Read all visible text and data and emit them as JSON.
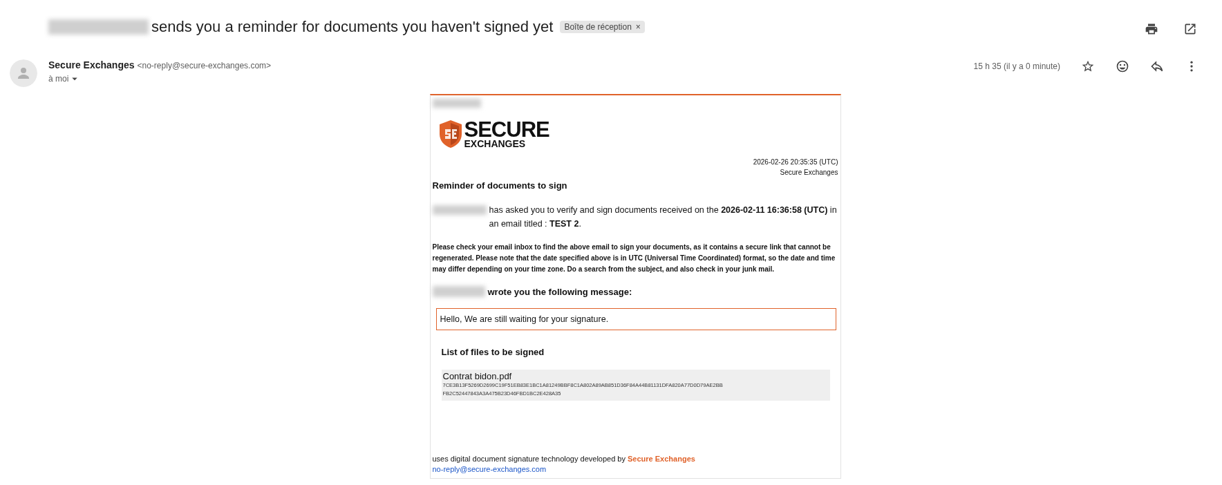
{
  "subject": {
    "text": "sends you a reminder for documents you haven't signed yet",
    "label_chip": "Boîte de réception",
    "chip_close": "×"
  },
  "sender": {
    "name": "Secure Exchanges",
    "address": "<no-reply@secure-exchanges.com>",
    "recipient": "à moi"
  },
  "time": "15 h 35 (il y a 0 minute)",
  "email": {
    "logo": [
      "SECURE",
      "EXCHANGES"
    ],
    "timestamp": "2026-02-26 20:35:35 (UTC)",
    "issuer": "Secure Exchanges",
    "heading": "Reminder of documents to sign",
    "request": "has asked you to verify and sign documents received on the **2026-02-11 16:36:58 (UTC)** in an email titled : **TEST 2**.",
    "notice": "Please check your email inbox to find the above email to sign your documents, as it contains a secure link that cannot be regenerated. Please note that the date specified above is in UTC (Universal Time Coordinated) format, so the date and time may differ depending on your time zone. Do a search from the subject, and also check in your junk mail.",
    "message_intro": "wrote you the following message:",
    "message": "Hello, We are still waiting for your signature.",
    "files_heading": "List of files to be signed",
    "files": [
      {
        "name": "Contrat bidon.pdf",
        "hash_lines": [
          "7CE3B13F5269D2699C19F51EB83E1BC1A81249BBF8C1A802A89AB851D36F84A44B81131DFA820A77D0D79AE2BB",
          "FB2C52447843A3A475B23D46FBD1BC2E428A35"
        ]
      }
    ],
    "footer": {
      "text": "uses digital document signature technology developed by",
      "brand": "Secure Exchanges",
      "email": "no-reply@secure-exchanges.com"
    }
  }
}
